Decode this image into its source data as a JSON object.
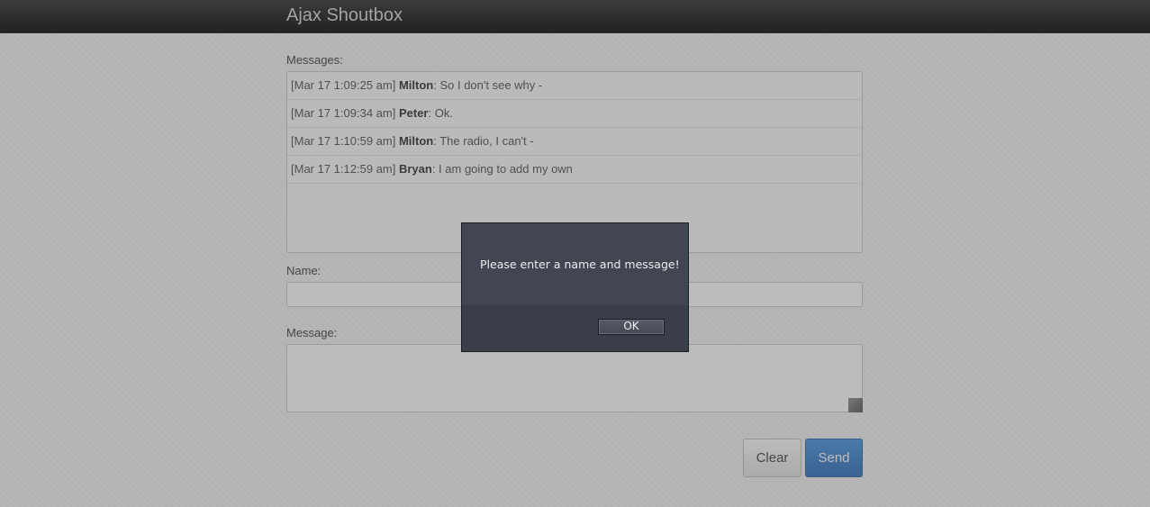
{
  "header": {
    "title": "Ajax Shoutbox"
  },
  "messages": {
    "label": "Messages:",
    "items": [
      {
        "timestamp": "[Mar 17 1:09:25 am]",
        "name": "Milton",
        "text": ": So I don't see why -"
      },
      {
        "timestamp": "[Mar 17 1:09:34 am]",
        "name": "Peter",
        "text": ": Ok."
      },
      {
        "timestamp": "[Mar 17 1:10:59 am]",
        "name": "Milton",
        "text": ": The radio, I can't -"
      },
      {
        "timestamp": "[Mar 17 1:12:59 am]",
        "name": "Bryan",
        "text": ": I am going to add my own"
      }
    ]
  },
  "form": {
    "name_label": "Name:",
    "name_value": "",
    "message_label": "Message:",
    "message_value": "",
    "clear_label": "Clear",
    "send_label": "Send"
  },
  "dialog": {
    "message": "Please enter a name and message!",
    "ok_label": "OK"
  },
  "colors": {
    "send_button": "#2a75cc",
    "navbar": "#2f2f2f",
    "dialog_bg": "#414652"
  }
}
